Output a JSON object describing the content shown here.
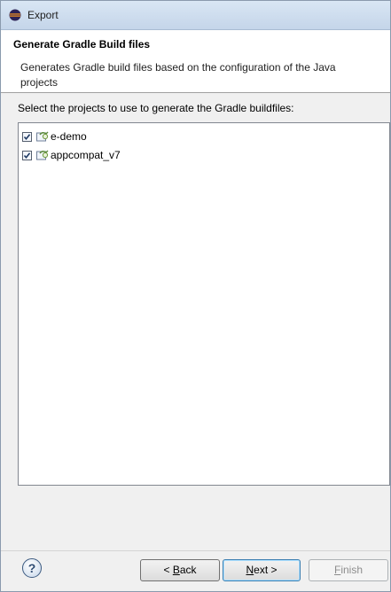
{
  "window": {
    "title": "Export"
  },
  "header": {
    "title": "Generate Gradle Build files",
    "description": "Generates Gradle build files based on the configuration of the Java projects"
  },
  "main": {
    "instruction": "Select the projects to use to generate the Gradle buildfiles:",
    "projects": [
      {
        "name": "e-demo",
        "checked": true,
        "icon": "android-project-icon"
      },
      {
        "name": "appcompat_v7",
        "checked": true,
        "icon": "android-project-icon"
      }
    ]
  },
  "footer": {
    "help_symbol": "?",
    "back_prefix": "< ",
    "back_mnemonic": "B",
    "back_rest": "ack",
    "next_mnemonic": "N",
    "next_rest": "ext >",
    "finish_mnemonic": "F",
    "finish_rest": "inish",
    "finish_enabled": false
  }
}
